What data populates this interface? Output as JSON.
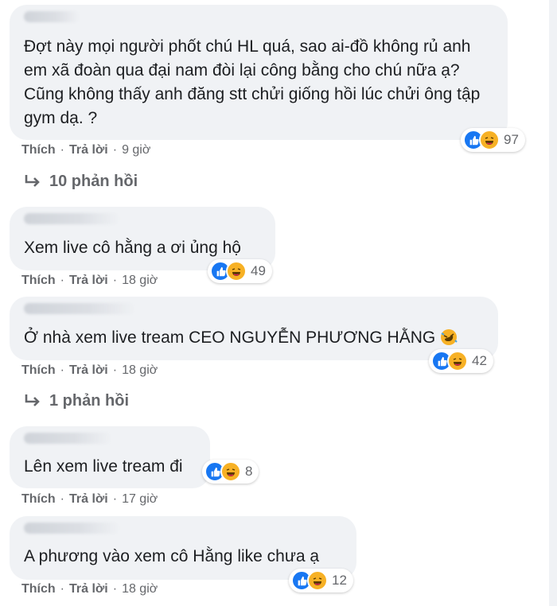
{
  "comments": [
    {
      "text": "Đợt này mọi người phốt chú HL quá, sao ai-đồ không rủ anh em xã đoàn qua đại nam đòi lại công bằng cho chú nữa ạ? Cũng không thấy anh đăng stt chửi giống hồi lúc chửi ông tập gym dạ. ?",
      "reaction_count": "97",
      "like": "Thích",
      "reply": "Trả lời",
      "time": "9 giờ",
      "replies_label": "10 phản hồi"
    },
    {
      "text": "Xem live cô hằng a ơi ủng hộ",
      "reaction_count": "49",
      "like": "Thích",
      "reply": "Trả lời",
      "time": "18 giờ"
    },
    {
      "text": "Ở nhà xem live tream CEO NGUYỄN PHƯƠNG HẰNG",
      "reaction_count": "42",
      "like": "Thích",
      "reply": "Trả lời",
      "time": "18 giờ",
      "replies_label": "1 phản hồi"
    },
    {
      "text": "Lên xem live tream đi",
      "reaction_count": "8",
      "like": "Thích",
      "reply": "Trả lời",
      "time": "17 giờ"
    },
    {
      "text": "A phương vào xem cô Hằng like chưa ạ",
      "reaction_count": "12",
      "like": "Thích",
      "reply": "Trả lời",
      "time": "18 giờ"
    }
  ],
  "separator": "·",
  "reaction_icons": [
    "like-icon",
    "haha-icon"
  ],
  "colors": {
    "like": "#1877f2",
    "haha": "#f7b125",
    "bubble": "#f0f2f5",
    "meta": "#65676b"
  }
}
